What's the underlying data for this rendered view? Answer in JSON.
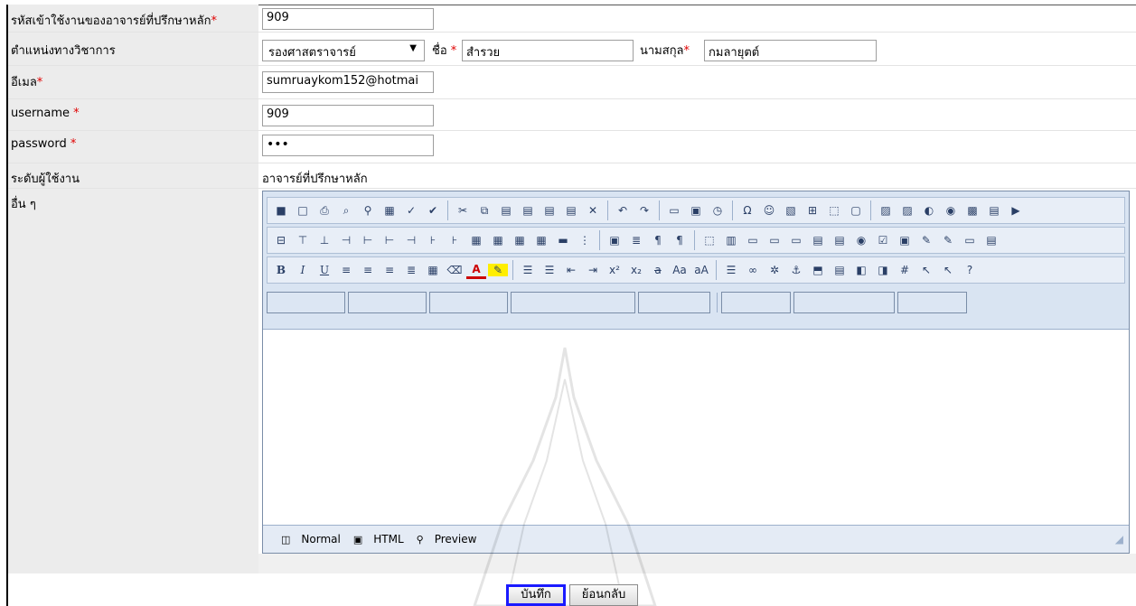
{
  "form": {
    "advisor_code": {
      "label": "รหัสเข้าใช้งานของอาจารย์ที่ปรึกษาหลัก",
      "required_mark": "*",
      "value": "909"
    },
    "academic_position": {
      "label": "ตำแหน่งทางวิชาการ",
      "selected": "รองศาสตราจารย์",
      "arrow": "▼"
    },
    "first_name": {
      "label": "ชื่อ",
      "required_mark": "*",
      "value": "สำรวย"
    },
    "last_name": {
      "label": "นามสกุล",
      "required_mark": "*",
      "value": "กมลายุตต์"
    },
    "email": {
      "label": "อีเมล",
      "required_mark": "*",
      "value": "sumruaykom152@hotmai"
    },
    "username": {
      "label": "username",
      "required_mark": "*",
      "value": "909"
    },
    "password": {
      "label": "password",
      "required_mark": "*",
      "value": "•••"
    },
    "user_level": {
      "label": "ระดับผู้ใช้งาน",
      "value": "อาจารย์ที่ปรึกษาหลัก"
    },
    "other": {
      "label": "อื่น ๆ"
    }
  },
  "editor": {
    "modes": [
      {
        "label": "Normal",
        "icon": "design-icon"
      },
      {
        "label": "HTML",
        "icon": "html-icon"
      },
      {
        "label": "Preview",
        "icon": "preview-icon"
      }
    ],
    "toolbar_row3": {
      "bold": "B",
      "italic": "I",
      "underline": "U",
      "font_color": "A"
    }
  },
  "buttons": {
    "save": "บันทึก",
    "back": "ย้อนกลับ"
  },
  "colors": {
    "required": "#e00000",
    "label_bg": "#ececec",
    "toolbar_bg": "#d9e4f2",
    "save_focus": "#1a1aff"
  }
}
